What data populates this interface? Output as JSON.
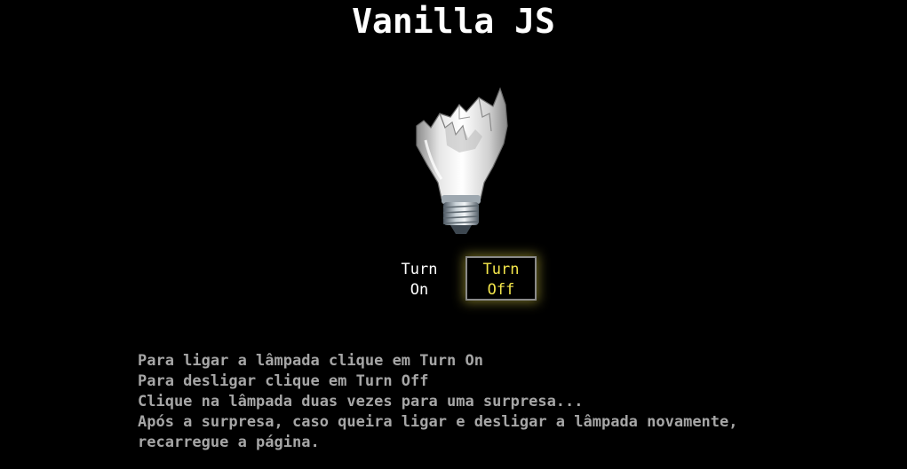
{
  "page": {
    "title": "Vanilla JS"
  },
  "bulb": {
    "state": "broken",
    "icon": "broken-lightbulb-icon"
  },
  "controls": {
    "turn_on_label": "Turn On",
    "turn_off_label": "Turn Off",
    "active_color": "#f4e64b",
    "inactive_color": "#ffffff"
  },
  "instructions": {
    "line1": "Para ligar a lâmpada clique em Turn On",
    "line2": "Para desligar clique em Turn Off",
    "line3": "Clique na lâmpada duas vezes para uma surpresa...",
    "line4": "Após a surpresa, caso queira ligar e desligar a lâmpada novamente,",
    "line5": "recarregue a página."
  },
  "colors": {
    "background": "#000000",
    "title": "#ffffff",
    "instruction_text": "#a6a6a6"
  }
}
